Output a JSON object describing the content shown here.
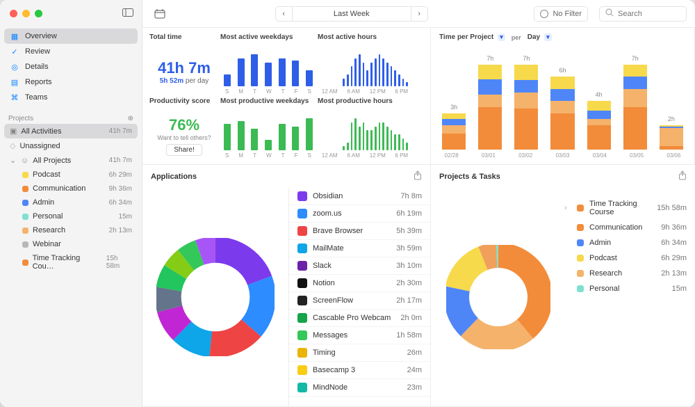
{
  "nav": {
    "items": [
      {
        "label": "Overview",
        "icon": "grid-icon"
      },
      {
        "label": "Review",
        "icon": "check-icon"
      },
      {
        "label": "Details",
        "icon": "target-icon"
      },
      {
        "label": "Reports",
        "icon": "document-icon"
      },
      {
        "label": "Teams",
        "icon": "people-icon"
      }
    ],
    "projects_header": "Projects",
    "all_activities": {
      "label": "All Activities",
      "duration": "41h 7m"
    },
    "unassigned": {
      "label": "Unassigned"
    },
    "all_projects": {
      "label": "All Projects",
      "duration": "41h 7m"
    },
    "projects": [
      {
        "label": "Podcast",
        "color": "#f7d94c",
        "duration": "6h 29m"
      },
      {
        "label": "Communication",
        "color": "#f28c3a",
        "duration": "9h 36m"
      },
      {
        "label": "Admin",
        "color": "#4f86f7",
        "duration": "6h 34m"
      },
      {
        "label": "Personal",
        "color": "#7fe0d1",
        "duration": "15m"
      },
      {
        "label": "Research",
        "color": "#f5b26b",
        "duration": "2h 13m"
      },
      {
        "label": "Webinar",
        "color": "#b8b8b8",
        "duration": ""
      },
      {
        "label": "Time Tracking Cou…",
        "color": "#f28c3a",
        "duration": "15h 58m"
      }
    ]
  },
  "toolbar": {
    "period": "Last Week",
    "filter_label": "No Filter",
    "search_placeholder": "Search"
  },
  "headers": {
    "total_time": "Total time",
    "active_weekdays": "Most active weekdays",
    "active_hours": "Most active hours",
    "productivity": "Productivity score",
    "productive_weekdays": "Most productive weekdays",
    "productive_hours": "Most productive hours",
    "time_per_project": "Time per Project",
    "per": "per",
    "day": "Day",
    "applications": "Applications",
    "projects_tasks": "Projects & Tasks"
  },
  "stats": {
    "total_time": "41h 7m",
    "per_day_bold": "5h 52m",
    "per_day_suffix": " per day",
    "score": "76%",
    "share_hint": "Want to tell others?",
    "share_btn": "Share!"
  },
  "applications": [
    {
      "name": "Obsidian",
      "duration": "7h 8m",
      "color": "#7c3aed"
    },
    {
      "name": "zoom.us",
      "duration": "6h 19m",
      "color": "#2d8cff"
    },
    {
      "name": "Brave Browser",
      "duration": "5h 39m",
      "color": "#ef4444"
    },
    {
      "name": "MailMate",
      "duration": "3h 59m",
      "color": "#0ea5e9"
    },
    {
      "name": "Slack",
      "duration": "3h 10m",
      "color": "#6b21a8"
    },
    {
      "name": "Notion",
      "duration": "2h 30m",
      "color": "#111"
    },
    {
      "name": "ScreenFlow",
      "duration": "2h 17m",
      "color": "#222"
    },
    {
      "name": "Cascable Pro Webcam",
      "duration": "2h 0m",
      "color": "#16a34a"
    },
    {
      "name": "Messages",
      "duration": "1h 58m",
      "color": "#34c759"
    },
    {
      "name": "Timing",
      "duration": "26m",
      "color": "#eab308"
    },
    {
      "name": "Basecamp 3",
      "duration": "24m",
      "color": "#facc15"
    },
    {
      "name": "MindNode",
      "duration": "23m",
      "color": "#14b8a6"
    }
  ],
  "projects_tasks": [
    {
      "name": "Time Tracking Course",
      "duration": "15h 58m",
      "color": "#f28c3a"
    },
    {
      "name": "Communication",
      "duration": "9h 36m",
      "color": "#f28c3a"
    },
    {
      "name": "Admin",
      "duration": "6h 34m",
      "color": "#4f86f7"
    },
    {
      "name": "Podcast",
      "duration": "6h 29m",
      "color": "#f7d94c"
    },
    {
      "name": "Research",
      "duration": "2h 13m",
      "color": "#f5b26b"
    },
    {
      "name": "Personal",
      "duration": "15m",
      "color": "#7fe0d1"
    }
  ],
  "chart_data": [
    {
      "id": "active_weekdays",
      "type": "bar",
      "color": "#2e5ee8",
      "categories": [
        "S",
        "M",
        "T",
        "W",
        "T",
        "F",
        "S"
      ],
      "values": [
        3,
        7,
        8,
        6,
        7,
        6.5,
        4
      ]
    },
    {
      "id": "active_hours",
      "type": "bar",
      "color": "#2e5ee8",
      "xticks": [
        "12 AM",
        "6 AM",
        "12 PM",
        "6 PM"
      ],
      "values": [
        0,
        0,
        0,
        0,
        0,
        0,
        2,
        3,
        5,
        7,
        8,
        6,
        4,
        6,
        7,
        8,
        7,
        6,
        5,
        4,
        3,
        2,
        1,
        0
      ]
    },
    {
      "id": "productive_weekdays",
      "type": "bar",
      "color": "#3cba54",
      "categories": [
        "S",
        "M",
        "T",
        "W",
        "T",
        "F",
        "S"
      ],
      "values": [
        5,
        5.5,
        4,
        2,
        5,
        4.5,
        6
      ]
    },
    {
      "id": "productive_hours",
      "type": "bar",
      "color": "#3cba54",
      "xticks": [
        "12 AM",
        "6 AM",
        "12 PM",
        "6 PM"
      ],
      "values": [
        0,
        0,
        0,
        0,
        0,
        0,
        1,
        2,
        7,
        8,
        6,
        7,
        5,
        5,
        6,
        7,
        7,
        6,
        5,
        4,
        4,
        3,
        2,
        0
      ]
    },
    {
      "id": "time_per_project",
      "type": "stacked_bar",
      "categories": [
        "02/28",
        "03/01",
        "03/02",
        "03/03",
        "03/04",
        "03/05",
        "03/06"
      ],
      "totals_label": [
        "3h",
        "7h",
        "7h",
        "6h",
        "4h",
        "7h",
        "2h"
      ],
      "series": [
        {
          "name": "Time Tracking Course",
          "color": "#f28c3a",
          "values": [
            1.3,
            3.5,
            3.4,
            3.0,
            2.0,
            3.5,
            0.3
          ]
        },
        {
          "name": "Communication",
          "color": "#f5b26b",
          "values": [
            0.7,
            1.0,
            1.3,
            1.0,
            0.5,
            1.5,
            1.5
          ]
        },
        {
          "name": "Admin",
          "color": "#4f86f7",
          "values": [
            0.5,
            1.3,
            1.0,
            1.0,
            0.7,
            1.0,
            0.1
          ]
        },
        {
          "name": "Podcast",
          "color": "#f7d94c",
          "values": [
            0.5,
            1.2,
            1.3,
            1.0,
            0.8,
            1.0,
            0.1
          ]
        }
      ],
      "ylim": [
        0,
        8
      ]
    },
    {
      "id": "applications_donut",
      "type": "pie",
      "slices": [
        {
          "name": "Obsidian",
          "value": 428,
          "color": "#7c3aed"
        },
        {
          "name": "zoom.us",
          "value": 379,
          "color": "#2d8cff"
        },
        {
          "name": "Brave Browser",
          "value": 339,
          "color": "#ef4444"
        },
        {
          "name": "MailMate",
          "value": 239,
          "color": "#0ea5e9"
        },
        {
          "name": "Slack",
          "value": 190,
          "color": "#c026d3"
        },
        {
          "name": "Notion",
          "value": 150,
          "color": "#64748b"
        },
        {
          "name": "ScreenFlow",
          "value": 137,
          "color": "#22c55e"
        },
        {
          "name": "Cascable",
          "value": 120,
          "color": "#84cc16"
        },
        {
          "name": "Messages",
          "value": 118,
          "color": "#34c759"
        },
        {
          "name": "Other",
          "value": 120,
          "color": "#a855f7"
        }
      ]
    },
    {
      "id": "projects_tasks_donut",
      "type": "pie",
      "slices": [
        {
          "name": "Time Tracking Course",
          "value": 958,
          "color": "#f28c3a"
        },
        {
          "name": "Communication",
          "value": 576,
          "color": "#f5b26b"
        },
        {
          "name": "Admin",
          "value": 394,
          "color": "#4f86f7"
        },
        {
          "name": "Podcast",
          "value": 389,
          "color": "#f7d94c"
        },
        {
          "name": "Research",
          "value": 133,
          "color": "#f0a05a"
        },
        {
          "name": "Personal",
          "value": 15,
          "color": "#7fe0d1"
        }
      ]
    }
  ]
}
